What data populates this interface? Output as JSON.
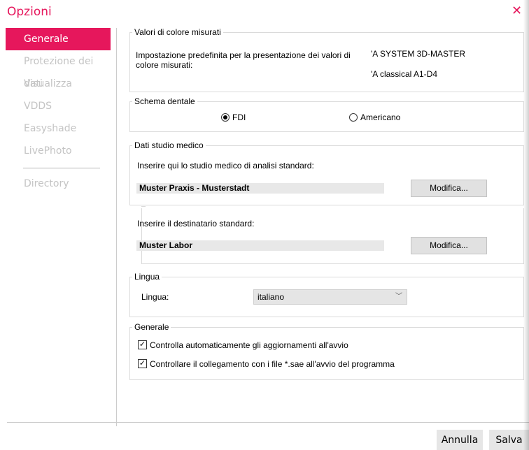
{
  "window": {
    "title": "Opzioni",
    "close_icon": "close-icon"
  },
  "sidebar": {
    "items": [
      {
        "label": "Generale",
        "active": true
      },
      {
        "label": "Protezione dei dati"
      },
      {
        "label": "Visualizza"
      },
      {
        "label": "VDDS"
      },
      {
        "label": "Easyshade"
      },
      {
        "label": "LivePhoto"
      },
      {
        "label": "Directory"
      }
    ]
  },
  "colori": {
    "legend": "Valori di colore misurati",
    "description": "Impostazione predefinita per la presentazione dei valori di colore misurati:",
    "option1": "'A SYSTEM 3D-MASTER",
    "option2": "'A classical A1-D4"
  },
  "schema": {
    "legend": "Schema dentale",
    "fdi": "FDI",
    "americano": "Americano",
    "selected": "FDI"
  },
  "studio": {
    "legend": "Dati studio medico",
    "prompt": "Inserire qui lo studio medico di analisi standard:",
    "value": "Muster Praxis  - Musterstadt",
    "edit": "Modifica...",
    "dest_prompt": "Inserire il destinatario standard:",
    "dest_value": "Muster Labor",
    "dest_edit": "Modifica..."
  },
  "lingua": {
    "legend": "Lingua",
    "label": "Lingua:",
    "value": "italiano"
  },
  "generale": {
    "legend": "Generale",
    "check1": "Controlla automaticamente gli aggiornamenti all'avvio",
    "check1_checked": true,
    "check2": "Controllare il collegamento con i file *.sae all'avvio del programma",
    "check2_checked": true
  },
  "footer": {
    "cancel": "Annulla",
    "save": "Salva"
  },
  "colors": {
    "accent": "#e6175c",
    "sidebar_inactive": "#c4c4c4"
  }
}
